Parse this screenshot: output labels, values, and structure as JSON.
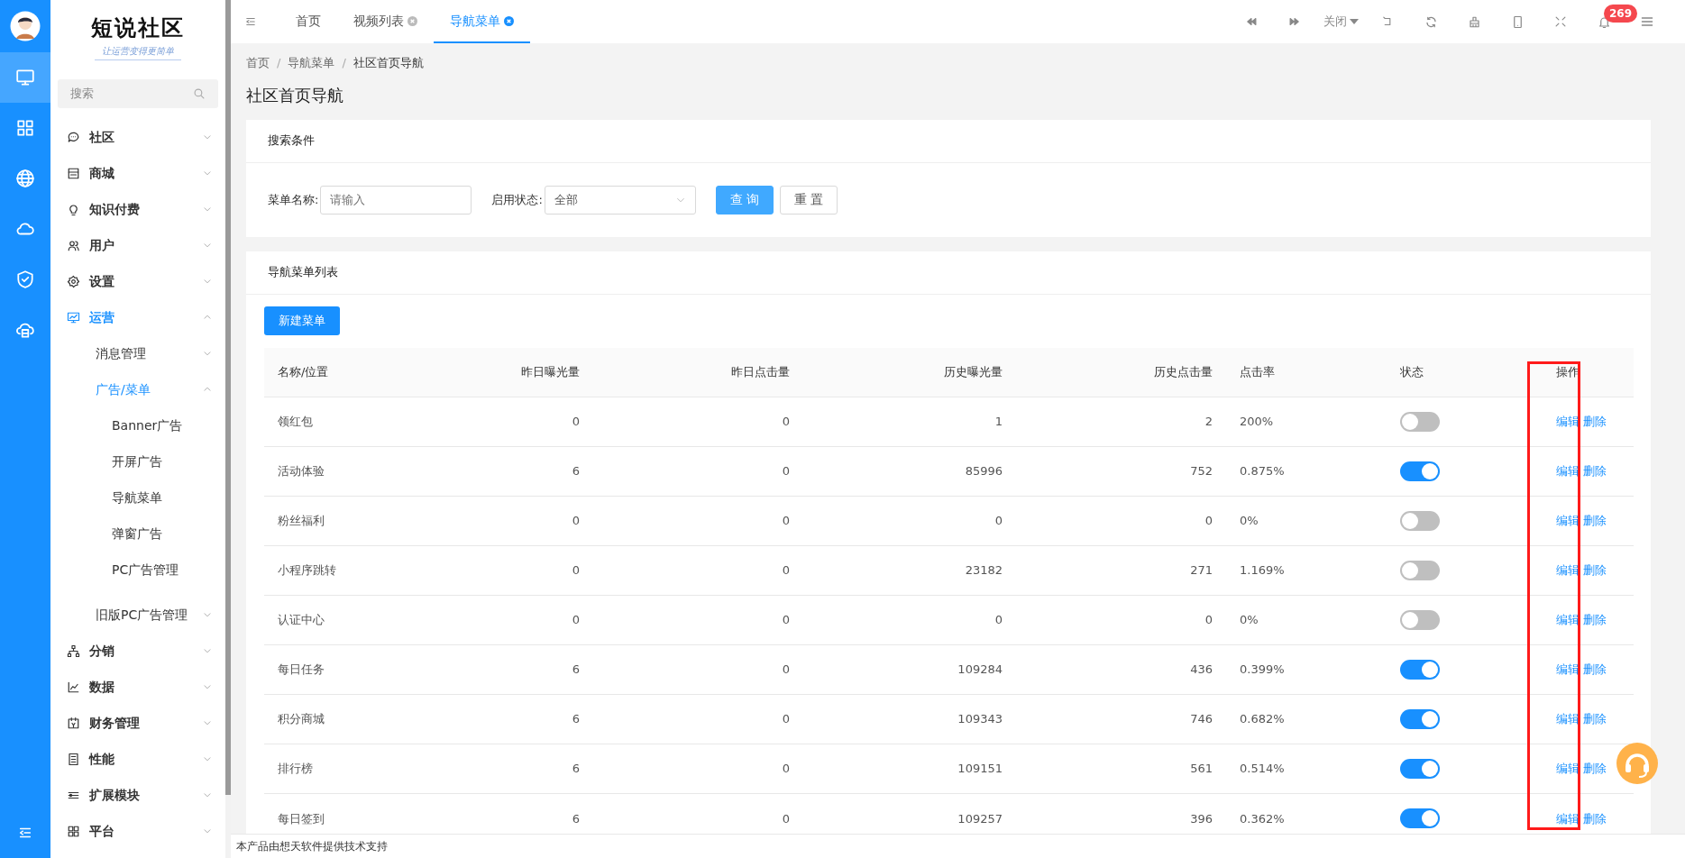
{
  "rail": {
    "items": [
      {
        "kind": "monitor",
        "selected": true
      },
      {
        "kind": "grid",
        "selected": false
      },
      {
        "kind": "globe",
        "selected": false
      },
      {
        "kind": "cloud",
        "selected": false
      },
      {
        "kind": "shield",
        "selected": false
      },
      {
        "kind": "cloud-box",
        "selected": false
      }
    ]
  },
  "brand": {
    "title": "短说社区",
    "slogan": "让运营变得更简单"
  },
  "sidebar": {
    "search_placeholder": "搜索",
    "items": [
      {
        "label": "社区",
        "expanded": false,
        "selected": false
      },
      {
        "label": "商城",
        "expanded": false,
        "selected": false
      },
      {
        "label": "知识付费",
        "expanded": false,
        "selected": false
      },
      {
        "label": "用户",
        "expanded": false,
        "selected": false
      },
      {
        "label": "设置",
        "expanded": false,
        "selected": false
      },
      {
        "label": "运营",
        "expanded": true,
        "selected": true,
        "children": [
          {
            "label": "消息管理",
            "expanded": false,
            "selected": false
          },
          {
            "label": "广告/菜单",
            "expanded": true,
            "selected": true,
            "children": [
              {
                "label": "Banner广告",
                "selected": false
              },
              {
                "label": "开屏广告",
                "selected": false
              },
              {
                "label": "导航菜单",
                "selected": false
              },
              {
                "label": "弹窗广告",
                "selected": false
              },
              {
                "label": "PC广告管理",
                "selected": false
              }
            ]
          },
          {
            "label": "旧版PC广告管理",
            "expanded": false,
            "selected": false
          }
        ]
      },
      {
        "label": "分销",
        "expanded": false,
        "selected": false
      },
      {
        "label": "数据",
        "expanded": false,
        "selected": false
      },
      {
        "label": "财务管理",
        "expanded": false,
        "selected": false
      },
      {
        "label": "性能",
        "expanded": false,
        "selected": false
      },
      {
        "label": "扩展模块",
        "expanded": false,
        "selected": false
      },
      {
        "label": "平台",
        "expanded": false,
        "selected": false
      }
    ]
  },
  "tabs": [
    {
      "label": "首页",
      "closable": false,
      "selected": false
    },
    {
      "label": "视频列表",
      "closable": true,
      "selected": false
    },
    {
      "label": "导航菜单",
      "closable": true,
      "selected": true
    }
  ],
  "toolbar": {
    "close_label": "关闭",
    "notification_count": "269"
  },
  "breadcrumb": [
    {
      "kind": "link",
      "text": "首页"
    },
    {
      "kind": "separator",
      "text": "/"
    },
    {
      "kind": "link",
      "text": "导航菜单"
    },
    {
      "kind": "separator",
      "text": "/"
    },
    {
      "kind": "current",
      "text": "社区首页导航"
    }
  ],
  "page_title": "社区首页导航",
  "search": {
    "title": "搜索条件",
    "fields": [
      {
        "kind": "input",
        "label": "菜单名称:",
        "placeholder": "请输入"
      },
      {
        "kind": "select",
        "label": "启用状态:",
        "value": "全部"
      }
    ],
    "buttons": [
      {
        "label": "查 询",
        "primary": true
      },
      {
        "label": "重 置",
        "primary": false
      }
    ]
  },
  "list": {
    "title": "导航菜单列表",
    "new_button": "新建菜单",
    "columns": [
      "名称/位置",
      "昨日曝光量",
      "昨日点击量",
      "历史曝光量",
      "历史点击量",
      "点击率",
      "状态",
      "操作"
    ],
    "rows": [
      {
        "cells": [
          "领红包",
          "0",
          "0",
          "1",
          "2",
          "200%"
        ],
        "enabled": false,
        "actions": [
          "编辑",
          "删除"
        ]
      },
      {
        "cells": [
          "活动体验",
          "6",
          "0",
          "85996",
          "752",
          "0.875%"
        ],
        "enabled": true,
        "actions": [
          "编辑",
          "删除"
        ]
      },
      {
        "cells": [
          "粉丝福利",
          "0",
          "0",
          "0",
          "0",
          "0%"
        ],
        "enabled": false,
        "actions": [
          "编辑",
          "删除"
        ]
      },
      {
        "cells": [
          "小程序跳转",
          "0",
          "0",
          "23182",
          "271",
          "1.169%"
        ],
        "enabled": false,
        "actions": [
          "编辑",
          "删除"
        ]
      },
      {
        "cells": [
          "认证中心",
          "0",
          "0",
          "0",
          "0",
          "0%"
        ],
        "enabled": false,
        "actions": [
          "编辑",
          "删除"
        ]
      },
      {
        "cells": [
          "每日任务",
          "6",
          "0",
          "109284",
          "436",
          "0.399%"
        ],
        "enabled": true,
        "actions": [
          "编辑",
          "删除"
        ]
      },
      {
        "cells": [
          "积分商城",
          "6",
          "0",
          "109343",
          "746",
          "0.682%"
        ],
        "enabled": true,
        "actions": [
          "编辑",
          "删除"
        ]
      },
      {
        "cells": [
          "排行榜",
          "6",
          "0",
          "109151",
          "561",
          "0.514%"
        ],
        "enabled": true,
        "actions": [
          "编辑",
          "删除"
        ]
      },
      {
        "cells": [
          "每日签到",
          "6",
          "0",
          "109257",
          "396",
          "0.362%"
        ],
        "enabled": true,
        "actions": [
          "编辑",
          "删除"
        ]
      }
    ]
  },
  "footer": "本产品由想天软件提供技术支持"
}
